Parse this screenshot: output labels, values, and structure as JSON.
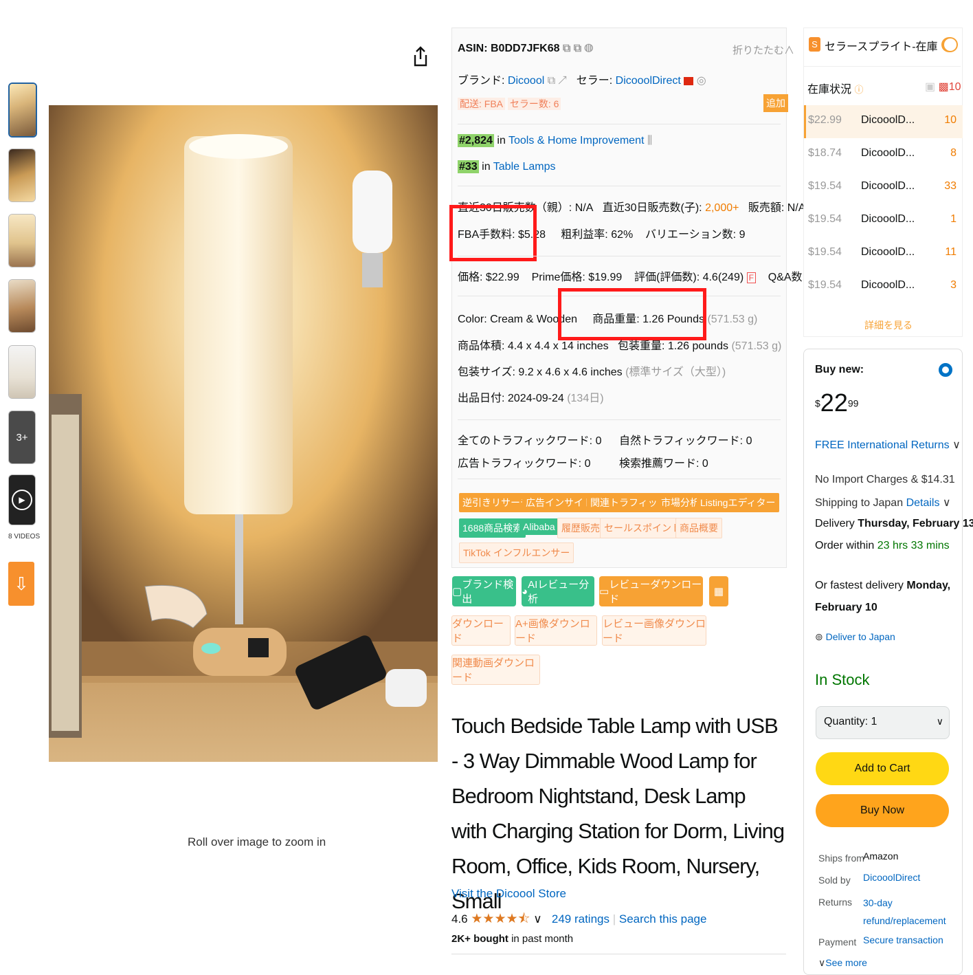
{
  "thumbnails": {
    "more_label": "3+",
    "videos_label": "8 VIDEOS"
  },
  "gallery": {
    "zoom_hint": "Roll over image to zoom in"
  },
  "ext_panel": {
    "asin": "ASIN: B0DD7JFK68",
    "collapse": "折りたたむ∧",
    "brand_label": "ブランド:",
    "brand": "Dicoool",
    "seller_label": "セラー:",
    "seller": "DicooolDirect",
    "shipping": "配送: FBA",
    "seller_count": "セラー数: 6",
    "add_label": "追加",
    "rank1": "#2,824",
    "rank1_in": "in",
    "rank1_cat": "Tools & Home Improvement",
    "rank2": "#33",
    "rank2_in": "in",
    "rank2_cat": "Table Lamps",
    "sales30_parent": "直近30日販売数（親）: N/A",
    "sales30_child_label": "直近30日販売数(子):",
    "sales30_child": "2,000+",
    "revenue": "販売額: N/A",
    "fba_fee": "FBA手数料: $5.28",
    "margin": "粗利益率: 62%",
    "variations": "バリエーション数: 9",
    "price": "価格: $22.99",
    "prime_price": "Prime価格: $19.99",
    "rating": "評価(評価数): 4.6(249)",
    "rating_badge": "F",
    "qa": "Q&A数: --",
    "color": "Color:  Cream & Wooden",
    "weight_label": "商品重量: 1.26 Pounds",
    "weight_g": "(571.53 g)",
    "dimensions": "商品体積: 4.4 x 4.4 x 14 inches",
    "pkg_weight": "包装重量: 1.26 pounds",
    "pkg_weight_g": "(571.53 g)",
    "pkg_size": "包装サイズ: 9.2 x 4.6 x 4.6 inches",
    "pkg_size_note": "(標準サイズ（大型）)",
    "listed": "出品日付: 2024-09-24",
    "listed_days": "(134日)",
    "kw_all": "全てのトラフィックワード: 0",
    "kw_natural": "自然トラフィックワード: 0",
    "kw_ads": "広告トラフィックワード: 0",
    "kw_search": "検索推薦ワード: 0",
    "tags_row1": [
      "逆引きリサーチ",
      "広告インサイト",
      "関連トラフィック",
      "市場分析",
      "Listingエディター"
    ],
    "tags_row2_green": [
      "1688商品検索",
      "Alibaba"
    ],
    "tags_row2_light": [
      "履歴販売",
      "セールスポイント",
      "商品概要"
    ],
    "tag_tiktok": "TikTok インフルエンサー"
  },
  "tools": {
    "brand_detect": "ブランド検出",
    "ai_review": "AIレビュー分析",
    "review_download": "レビューダウンロード",
    "download": "ダウンロード",
    "aplus_download": "A+画像ダウンロード",
    "review_img_download": "レビュー画像ダウンロード",
    "video_download": "関連動画ダウンロード"
  },
  "product": {
    "title": "Touch Bedside Table Lamp with USB - 3 Way Dimmable Wood Lamp for Bedroom Nightstand, Desk Lamp with Charging Station for Dorm, Living Room, Office, Kids Room, Nursery, Small",
    "store_link": "Visit the Dicoool Store",
    "rating": "4.6",
    "rating_value": 4.6,
    "ratings_count": "249 ratings",
    "search_page": "Search this page",
    "bought_bold": "2K+ bought",
    "bought_rest": "in past month"
  },
  "seller_panel": {
    "title": "セラースプライト-在庫",
    "stock_label": "在庫状況",
    "stock_total": "10",
    "rows": [
      {
        "price": "$22.99",
        "seller": "DicooolD...",
        "qty": "10"
      },
      {
        "price": "$18.74",
        "seller": "DicooolD...",
        "qty": "8"
      },
      {
        "price": "$19.54",
        "seller": "DicooolD...",
        "qty": "33"
      },
      {
        "price": "$19.54",
        "seller": "DicooolD...",
        "qty": "1"
      },
      {
        "price": "$19.54",
        "seller": "DicooolD...",
        "qty": "11"
      },
      {
        "price": "$19.54",
        "seller": "DicooolD...",
        "qty": "3"
      }
    ],
    "more": "詳細を見る"
  },
  "buybox": {
    "buy_new": "Buy new:",
    "price_symbol": "$",
    "price_whole": "22",
    "price_cents": "99",
    "returns": "FREE International Returns",
    "import_line": "No Import Charges & $14.31",
    "shipping_to": "Shipping to Japan",
    "details": "Details",
    "delivery_label": "Delivery",
    "delivery_date": "Thursday, February 13",
    "order_within": "Order within",
    "countdown": "23 hrs 33 mins",
    "fastest_label": "Or fastest delivery",
    "fastest_date": "Monday, February 10",
    "deliver_to": "Deliver to Japan",
    "in_stock": "In Stock",
    "quantity": "Quantity: 1",
    "add_to_cart": "Add to Cart",
    "buy_now": "Buy Now",
    "ships_from_label": "Ships from",
    "ships_from": "Amazon",
    "sold_by_label": "Sold by",
    "sold_by": "DicooolDirect",
    "returns_label": "Returns",
    "returns_value": "30-day refund/replacement",
    "payment_label": "Payment",
    "payment_value": "Secure transaction",
    "see_more": "See more"
  },
  "colors": {
    "accent_orange": "#f7a234",
    "green": "#39c08a",
    "add_to_cart": "#ffd814",
    "buy_now": "#ffa41c",
    "highlight": "#ff1a1a",
    "in_stock": "#007600"
  }
}
